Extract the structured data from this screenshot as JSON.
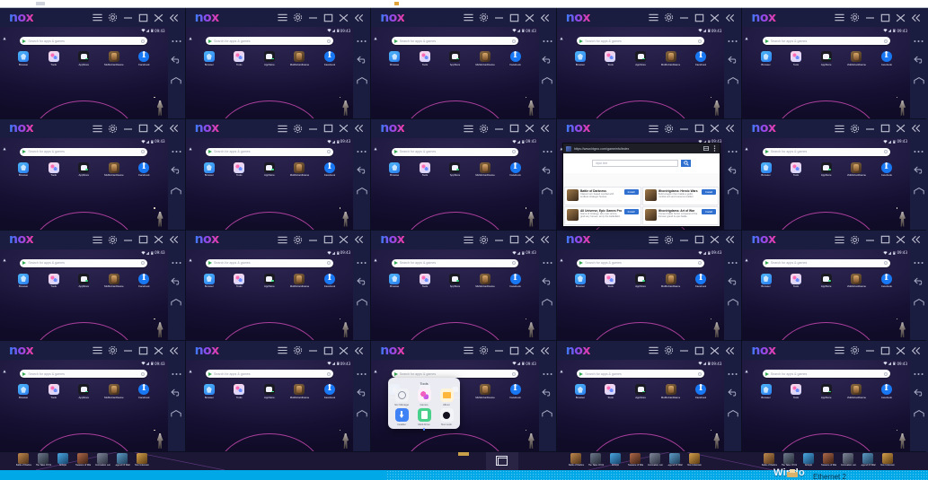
{
  "desktop": {
    "window_count": 20,
    "grid": {
      "columns": 5,
      "rows": 4
    },
    "background_color": "#10122c",
    "taskbar_color": "#00a8e8"
  },
  "nox_window": {
    "app_title": "nox",
    "titlebar_buttons": [
      {
        "name": "menu-button",
        "icon": "hamburger-icon",
        "label": "Menu"
      },
      {
        "name": "settings-button",
        "icon": "gear-icon",
        "label": "Settings"
      },
      {
        "name": "minimize-button",
        "icon": "minimize-icon",
        "label": "Minimize"
      },
      {
        "name": "maximize-button",
        "icon": "maximize-icon",
        "label": "Maximize"
      },
      {
        "name": "close-button",
        "icon": "close-icon",
        "label": "Close"
      },
      {
        "name": "collapse-toolbar-button",
        "icon": "chevron-double-left-icon",
        "label": "Collapse"
      }
    ],
    "status_bar": {
      "wifi": "wifi-icon",
      "signal": "signal-icon",
      "battery": "battery-icon",
      "clock": "09:43"
    },
    "play_search": {
      "placeholder": "Search for apps & games",
      "voice_icon": "mic-icon",
      "play_icon": "google-play-icon"
    },
    "home_apps": [
      {
        "label": "Browser",
        "icon": "browser-icon"
      },
      {
        "label": "Tools",
        "icon": "tools-folder-icon"
      },
      {
        "label": "AppStore",
        "icon": "appstore-icon"
      },
      {
        "label": "MuMuCardGame",
        "icon": "game-icon"
      },
      {
        "label": "Facebook",
        "icon": "facebook-icon"
      }
    ],
    "dock_buttons": [
      {
        "name": "more-options-button",
        "icon": "more-horizontal-icon",
        "label": "More"
      },
      {
        "name": "back-button",
        "icon": "back-arrow-icon",
        "label": "Back"
      },
      {
        "name": "home-button",
        "icon": "home-icon",
        "label": "Home"
      }
    ],
    "wallpaper": {
      "description": "dark purple gradient with magenta arc and character silhouette",
      "arc_color": "#d64dbc"
    }
  },
  "browser_overlay": {
    "url": "https://www.bigno.com/gameinfo/index",
    "menu_icon": "kebab-menu-icon",
    "tabs_icon": "tabs-icon",
    "search": {
      "placeholder": "Input text",
      "button_icon": "search-icon",
      "button_color": "#2f6fd0"
    },
    "cards": [
      {
        "title": "Battle of Darkness",
        "desc": "Classic turn based combat with endless strategic heroes.",
        "action": "Install"
      },
      {
        "title": "Mhordrigdams: Heroic Wars",
        "desc": "Build a legion then battle a guild, combat unit and resource builder.",
        "action": "Install"
      },
      {
        "title": "All Universe, Epic Games Pro",
        "desc": "Game of strategy, lazy epic anime, grab any heroes, army the battlefield.",
        "action": "Install"
      },
      {
        "title": "Mhordrigdams: Art of War",
        "desc": "Pioneer battle heroic conquest of the 3rd war grand & epic battle.",
        "action": "Install"
      }
    ]
  },
  "tools_folder_overlay": {
    "title": "Tools",
    "apps": [
      {
        "label": "Nox Manager",
        "icon": "settings-gear-icon"
      },
      {
        "label": "Games",
        "icon": "games-icon"
      },
      {
        "label": "Album",
        "icon": "album-icon"
      },
      {
        "label": "Installer",
        "icon": "download-icon"
      },
      {
        "label": "Multi-Drive",
        "icon": "drive-icon"
      },
      {
        "label": "Nox Lock",
        "icon": "lock-icon"
      }
    ],
    "page_indicator": "page-dot"
  },
  "game_taskbar": {
    "items": [
      {
        "label": "Battle of Darkness",
        "icon": "game-icon-1"
      },
      {
        "label": "The Tales Of Kings",
        "icon": "game-icon-2"
      },
      {
        "label": "All Epic",
        "icon": "game-icon-3"
      },
      {
        "label": "Treasure of Warriors",
        "icon": "game-icon-4"
      },
      {
        "label": "Domination Lord 3",
        "icon": "game-icon-5"
      },
      {
        "label": "Legend Of Warrior Pro",
        "icon": "game-icon-6"
      },
      {
        "label": "Nox Unknown",
        "icon": "game-icon-7"
      }
    ],
    "task_view": {
      "label": "Task View",
      "icon": "task-view-icon"
    }
  },
  "windows_taskbar": {
    "window_label": "Windo",
    "network_label": "Ethernet 2",
    "network_icon": "ethernet-icon"
  }
}
